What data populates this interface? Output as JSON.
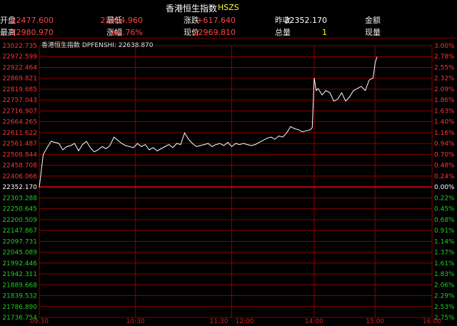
{
  "header": {
    "title": "香港恒生指数",
    "code": "HSZS",
    "row1": [
      {
        "label": "开盘",
        "value": "22477.600",
        "color": "#ff4444"
      },
      {
        "label": "最低",
        "value": "22454.960",
        "color": "#ff4444"
      },
      {
        "label": "涨跌",
        "value": "+617.640",
        "color": "#ff4444"
      },
      {
        "label": "昨收",
        "value": "22352.170",
        "color": "#ffffff"
      },
      {
        "label": "金额",
        "value": "",
        "color": "#ffffff"
      }
    ],
    "row2": [
      {
        "label": "最高",
        "value": "22980.970",
        "color": "#ff4444"
      },
      {
        "label": "涨幅",
        "value": "+2.76%",
        "color": "#ff4444"
      },
      {
        "label": "现价",
        "value": "22969.810",
        "color": "#ff4444"
      },
      {
        "label": "总量",
        "value": "1",
        "color": "#ffff00"
      },
      {
        "label": "现量",
        "value": "",
        "color": "#ffff00"
      }
    ]
  },
  "legend": {
    "text": "香港恒生指数 DPFENSHI: 22638.870"
  },
  "colors": {
    "up": "#ff3333",
    "down": "#22cc22",
    "grid": "#8b0000",
    "line": "#ffffff",
    "base": "#ff0000"
  },
  "chart_data": {
    "type": "line",
    "base": 22352.17,
    "left_ticks": [
      "23022.735",
      "22972.599",
      "22922.464",
      "22869.821",
      "22819.685",
      "22757.043",
      "22716.907",
      "22664.265",
      "22611.622",
      "22561.487",
      "22508.844",
      "22458.708",
      "22406.066",
      "22352.170",
      "22303.288",
      "22250.645",
      "22200.509",
      "22147.867",
      "22097.731",
      "22045.089",
      "21992.446",
      "21942.311",
      "21889.668",
      "21839.532",
      "21786.890",
      "21736.754"
    ],
    "right_ticks": [
      "3.00%",
      "2.78%",
      "2.55%",
      "2.32%",
      "2.09%",
      "1.86%",
      "1.63%",
      "1.40%",
      "1.16%",
      "0.94%",
      "0.70%",
      "0.48%",
      "0.24%",
      "0.00%",
      "0.22%",
      "0.45%",
      "0.68%",
      "0.91%",
      "1.14%",
      "1.37%",
      "1.61%",
      "1.83%",
      "2.06%",
      "2.29%",
      "2.53%",
      "2.75%"
    ],
    "x_labels": [
      "09:30",
      "10:30",
      "11:30",
      "12:00",
      "14:00",
      "15:00",
      "16:00"
    ],
    "x_positions": [
      0,
      0.245,
      0.49,
      0.49,
      0.7,
      0.855,
      1.0
    ],
    "ylim": [
      21736.754,
      23022.735
    ],
    "series": [
      {
        "x": [
          0,
          0.01,
          0.02,
          0.03,
          0.05,
          0.06,
          0.07,
          0.08,
          0.09,
          0.1,
          0.11,
          0.12,
          0.13,
          0.14,
          0.15,
          0.16,
          0.17,
          0.18,
          0.19,
          0.2,
          0.21,
          0.22,
          0.23,
          0.24,
          0.25,
          0.26,
          0.27,
          0.28,
          0.29,
          0.3,
          0.31,
          0.32,
          0.33,
          0.34,
          0.35,
          0.36,
          0.37,
          0.38,
          0.39,
          0.4,
          0.41,
          0.42,
          0.43,
          0.44,
          0.45,
          0.46,
          0.47,
          0.48,
          0.49,
          0.5,
          0.51,
          0.52,
          0.53,
          0.54,
          0.55,
          0.56,
          0.57,
          0.58,
          0.59,
          0.6,
          0.61,
          0.62,
          0.63,
          0.64,
          0.65,
          0.66,
          0.67,
          0.68,
          0.69,
          0.695,
          0.7,
          0.705,
          0.71,
          0.72,
          0.73,
          0.74,
          0.75,
          0.76,
          0.77,
          0.78,
          0.79,
          0.8,
          0.81,
          0.82,
          0.83,
          0.84,
          0.85,
          0.855,
          0.86
        ],
        "y": [
          22352,
          22508,
          22540,
          22570,
          22560,
          22530,
          22545,
          22550,
          22560,
          22525,
          22555,
          22570,
          22540,
          22520,
          22530,
          22545,
          22535,
          22550,
          22590,
          22575,
          22560,
          22550,
          22545,
          22540,
          22560,
          22545,
          22555,
          22530,
          22540,
          22525,
          22535,
          22545,
          22555,
          22540,
          22560,
          22555,
          22610,
          22580,
          22560,
          22545,
          22550,
          22555,
          22560,
          22545,
          22555,
          22560,
          22550,
          22565,
          22545,
          22560,
          22555,
          22560,
          22555,
          22550,
          22555,
          22565,
          22575,
          22585,
          22590,
          22580,
          22595,
          22590,
          22610,
          22640,
          22630,
          22625,
          22615,
          22620,
          22625,
          22635,
          22870,
          22810,
          22820,
          22790,
          22810,
          22800,
          22760,
          22770,
          22800,
          22760,
          22780,
          22810,
          22820,
          22830,
          22810,
          22860,
          22870,
          22940,
          22970
        ]
      }
    ]
  }
}
